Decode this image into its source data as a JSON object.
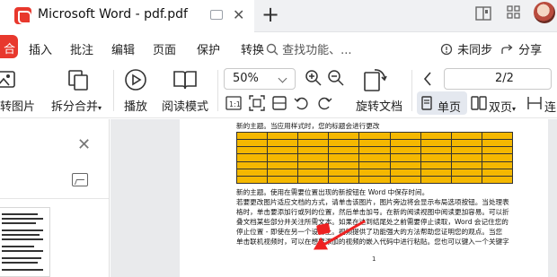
{
  "titlebar": {
    "title": "Microsoft Word - pdf.pdf",
    "close_glyph": "✕",
    "new_tab_glyph": "+",
    "brand_color": "#e8382d"
  },
  "menu": {
    "items": [
      "合",
      "插入",
      "批注",
      "编辑",
      "页面",
      "保护",
      "转换"
    ],
    "search_placeholder": "查找功能、...",
    "sync_label": "未同步",
    "share_label": "分享"
  },
  "toolbar": {
    "convert_image": "转图片",
    "split_merge": "拆分合并",
    "play": "播放",
    "read_mode": "阅读模式",
    "zoom_value": "50%",
    "rotate_doc": "旋转文档",
    "page_value": "2/2",
    "single_page": "单页",
    "double_page": "双页",
    "continuous": "连"
  },
  "leftpanel": {
    "close_glyph": "✕"
  },
  "document": {
    "line1": "新的主题。当应用样式时，您的标题会进行更改",
    "line2": "新的主题。使用在需要位置出现的新按钮在 Word 中保存时间。",
    "line3": "若要更改图片适应文档的方式，请单击该图片，图片旁边将会显示布局选项按钮。当处理表",
    "line4": "格时，单击要添加行或列的位置，然后单击加号。在新的阅读视图中阅读更加容易。可以折",
    "line5": "叠文档某些部分并关注所需文本。如果在达到结尾处之前需要停止读取，Word 会记住您的",
    "line6": "停止位置 - 即使在另一个设备上。视频提供了功能强大的方法帮助您证明您的观点。当您",
    "line7": "单击联机视频时，可以在想要添加的视频的嵌入代码中进行粘贴。您也可以键入一个关键字",
    "page_number": "1",
    "table_color": "#f5b800",
    "annotation_color": "#e22222"
  }
}
